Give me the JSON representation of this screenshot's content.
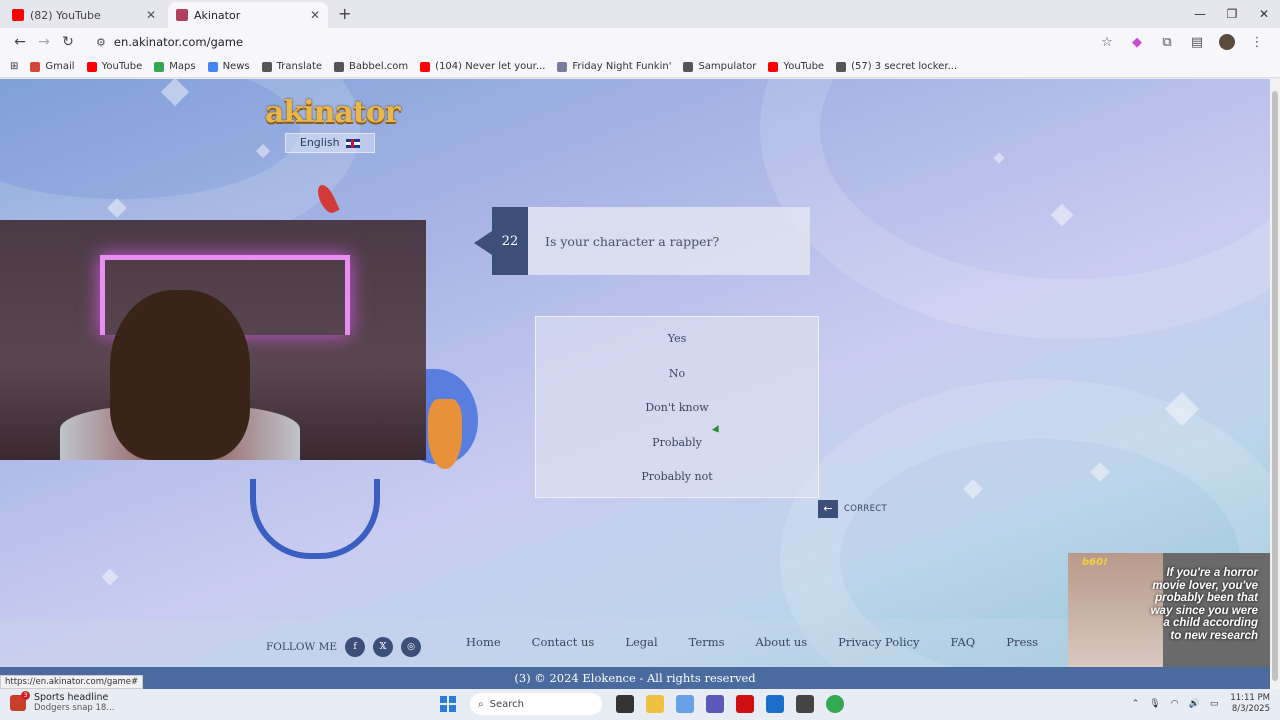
{
  "browser": {
    "tabs": [
      {
        "title": "(82) YouTube",
        "color": "#ff0000"
      },
      {
        "title": "Akinator",
        "color": "#b04060"
      }
    ],
    "new_tab": "+",
    "url": "en.akinator.com/game",
    "window_controls": [
      "—",
      "❐",
      "✕"
    ],
    "bookmarks": [
      {
        "label": "Gmail",
        "color": "#d44638"
      },
      {
        "label": "YouTube",
        "color": "#ff0000"
      },
      {
        "label": "Maps",
        "color": "#34a853"
      },
      {
        "label": "News",
        "color": "#4285f4"
      },
      {
        "label": "Translate",
        "color": "#555555"
      },
      {
        "label": "Babbel.com",
        "color": "#555555"
      },
      {
        "label": "(104) Never let your...",
        "color": "#ff0000"
      },
      {
        "label": "Friday Night Funkin'",
        "color": "#7a7aa0"
      },
      {
        "label": "Sampulator",
        "color": "#555555"
      },
      {
        "label": "YouTube",
        "color": "#ff0000"
      },
      {
        "label": "(57) 3 secret locker...",
        "color": "#555555"
      }
    ]
  },
  "site": {
    "logo": "akinator",
    "language": "English",
    "question_number": "22",
    "question": "Is your character a rapper?",
    "answers": [
      "Yes",
      "No",
      "Don't know",
      "Probably",
      "Probably not"
    ],
    "correct_label": "CORRECT",
    "follow_label": "FOLLOW ME",
    "social": [
      "f",
      "𝕏",
      "◎"
    ],
    "footer_links": [
      "Home",
      "Contact us",
      "Legal",
      "Terms",
      "About us",
      "Privacy Policy",
      "FAQ",
      "Press"
    ],
    "copyright": "(3)  © 2024 Elokence - All rights reserved",
    "status_url": "https://en.akinator.com/game#"
  },
  "ad": {
    "brand": "b60!",
    "text": "If you're a horror movie lover, you've probably been that way since you were a child according to new research"
  },
  "taskbar": {
    "news_title": "Sports headline",
    "news_sub": "Dodgers snap 18...",
    "search": "Search",
    "time": "11:11 PM",
    "date": "8/3/2025"
  }
}
